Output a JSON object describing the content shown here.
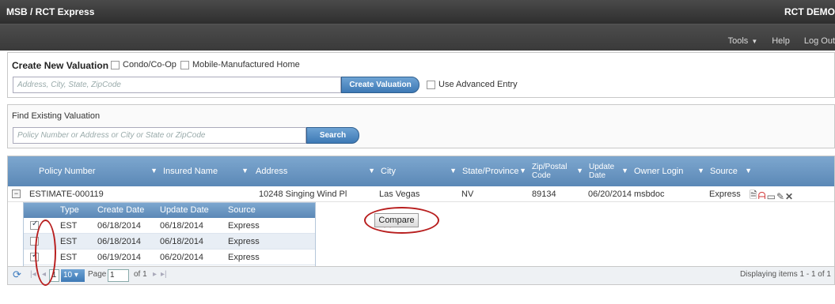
{
  "app": {
    "title": "MSB / RCT Express",
    "company": "RCT DEMO"
  },
  "nav": {
    "tools": "Tools",
    "help": "Help",
    "logout": "Log Out"
  },
  "create": {
    "title": "Create New Valuation",
    "condo_label": "Condo/Co-Op",
    "mobile_label": "Mobile-Manufactured Home",
    "address_placeholder": "Address, City, State, ZipCode",
    "create_button": "Create Valuation",
    "advanced_label": "Use Advanced Entry"
  },
  "find": {
    "title": "Find Existing Valuation",
    "placeholder": "Policy Number or Address or City or State or ZipCode",
    "search_button": "Search"
  },
  "grid": {
    "columns": [
      "Policy Number",
      "Insured Name",
      "Address",
      "City",
      "State/Province",
      "Zip/Postal Code",
      "Update Date",
      "Owner Login",
      "Source"
    ],
    "row": {
      "policy": "ESTIMATE-000119",
      "insured": "",
      "address": "10248 Singing Wind Pl",
      "city": "Las Vegas",
      "state": "NV",
      "zip": "89134",
      "update": "06/20/2014",
      "owner": "msbdoc",
      "source": "Express"
    },
    "sub_columns": [
      "Type",
      "Create Date",
      "Update Date",
      "Source"
    ],
    "sub_rows": [
      {
        "type": "EST",
        "create": "06/18/2014",
        "update": "06/18/2014",
        "source": "Express",
        "checked": true
      },
      {
        "type": "EST",
        "create": "06/18/2014",
        "update": "06/18/2014",
        "source": "Express",
        "checked": false
      },
      {
        "type": "EST",
        "create": "06/19/2014",
        "update": "06/20/2014",
        "source": "Express",
        "checked": true
      }
    ],
    "compare_button": "Compare"
  },
  "pager": {
    "current_page": "1",
    "page_size": "10",
    "page_label": "Page",
    "page_input": "1",
    "of_label": "of 1",
    "summary": "Displaying items 1 - 1 of 1"
  }
}
